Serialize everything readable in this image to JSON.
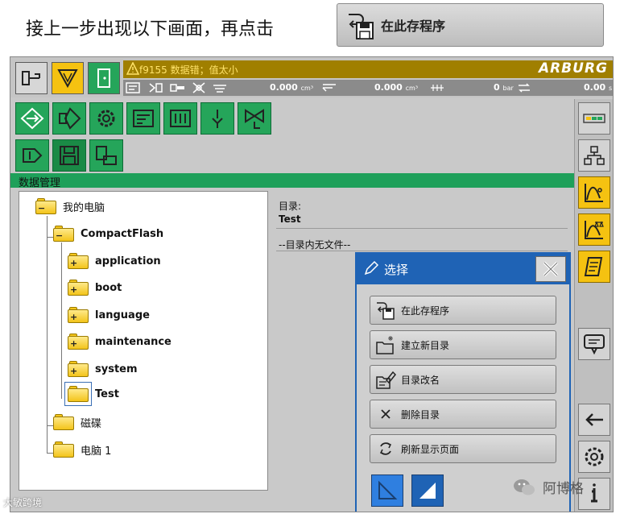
{
  "instruction": {
    "text": "接上一步出现以下画面，再点击",
    "button_label": "在此存程序"
  },
  "status_bar": {
    "alarm_text": "f9155 数据错；值太小",
    "brand": "ARBURG",
    "readouts": [
      {
        "value": "0.000",
        "unit": "cm³"
      },
      {
        "value": "0.000",
        "unit": "cm³"
      },
      {
        "value": "0",
        "unit": "bar"
      },
      {
        "value": "0.00",
        "unit": "s"
      }
    ]
  },
  "section": {
    "title": "数据管理"
  },
  "tree": {
    "items": [
      {
        "label": "我的电脑",
        "level": 0,
        "expander": "−"
      },
      {
        "label": "CompactFlash",
        "level": 1,
        "expander": "−"
      },
      {
        "label": "application",
        "level": 2,
        "expander": "+"
      },
      {
        "label": "boot",
        "level": 2,
        "expander": "+"
      },
      {
        "label": "language",
        "level": 2,
        "expander": "+"
      },
      {
        "label": "maintenance",
        "level": 2,
        "expander": "+"
      },
      {
        "label": "system",
        "level": 2,
        "expander": "+"
      },
      {
        "label": "Test",
        "level": 2,
        "expander": "",
        "selected": true
      },
      {
        "label": "磁碟",
        "level": 1,
        "expander": ""
      },
      {
        "label": "电脑 1",
        "level": 1,
        "expander": ""
      }
    ]
  },
  "detail": {
    "dir_label": "目录:",
    "dir_value": "Test",
    "empty_note": "--目录内无文件--"
  },
  "dialog": {
    "title": "选择",
    "options": [
      {
        "label": "在此存程序",
        "icon": "save-here-icon"
      },
      {
        "label": "建立新目录",
        "icon": "new-folder-icon"
      },
      {
        "label": "目录改名",
        "icon": "rename-folder-icon"
      },
      {
        "label": "删除目录",
        "icon": "delete-icon"
      },
      {
        "label": "刷新显示页面",
        "icon": "refresh-icon"
      }
    ]
  },
  "watermarks": {
    "left": "大敏跨境",
    "right": "阿博格"
  },
  "colors": {
    "accent_green": "#25a55a",
    "dialog_blue": "#1f63b5",
    "highlight_yellow": "#f5c211"
  }
}
